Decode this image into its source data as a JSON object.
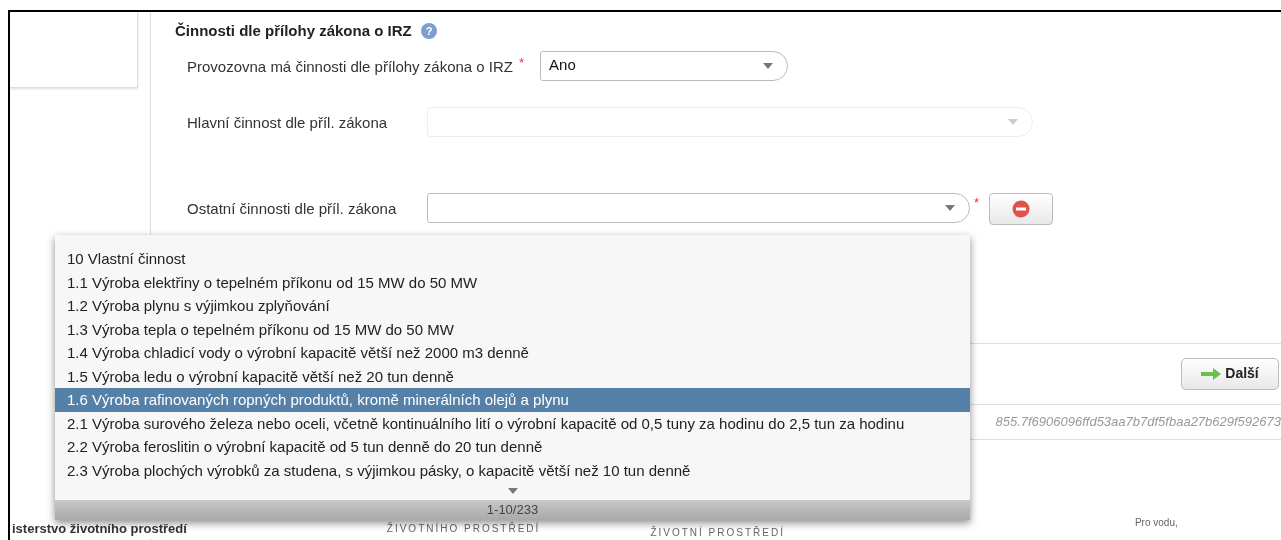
{
  "section": {
    "title": "Činnosti dle přílohy zákona o IRZ",
    "help_icon": "?"
  },
  "required_mark": "*",
  "fields": [
    {
      "label": "Provozovna má činnosti dle přílohy zákona o IRZ",
      "required": true,
      "value": "Ano",
      "disabled": false,
      "kind": "short",
      "removable": false
    },
    {
      "label": "Hlavní činnost dle příl. zákona",
      "required": false,
      "disabled": true,
      "kind": "wide",
      "removable": false
    },
    {
      "label": "Ostatní činnosti dle příl. zákona",
      "required": true,
      "disabled": false,
      "kind": "medium",
      "removable": true
    }
  ],
  "dropdown": {
    "options": [
      {
        "label": "10 Vlastní činnost",
        "selected": false
      },
      {
        "label": "1.1 Výroba elektřiny o tepelném příkonu od 15 MW do 50 MW",
        "selected": false
      },
      {
        "label": "1.2 Výroba plynu s výjimkou zplyňování",
        "selected": false
      },
      {
        "label": "1.3 Výroba tepla o tepelném příkonu od 15 MW do 50 MW",
        "selected": false
      },
      {
        "label": "1.4 Výroba chladicí vody o výrobní kapacitě větší než 2000 m3 denně",
        "selected": false
      },
      {
        "label": "1.5 Výroba ledu o výrobní kapacitě větší než 20 tun denně",
        "selected": false
      },
      {
        "label": "1.6 Výroba rafinovaných ropných produktů, kromě minerálních olejů a plynu",
        "selected": true
      },
      {
        "label": "2.1 Výroba surového železa nebo oceli, včetně kontinuálního lití o výrobní kapacitě od 0,5 tuny za hodinu do 2,5 tun za hodinu",
        "selected": false
      },
      {
        "label": "2.2 Výroba feroslitin o výrobní kapacitě od 5 tun denně do 20 tun denně",
        "selected": false
      },
      {
        "label": "2.3 Výroba plochých výrobků za studena, s výjimkou pásky, o kapacitě větší než 10 tun denně",
        "selected": false
      }
    ],
    "pager": "1-10/233"
  },
  "next_button": "Další",
  "hash": "855.7f6906096ffd53aa7b7df5fbaa27b629f592673",
  "footer": {
    "ministry": "isterstvo životního prostředí",
    "logo_caption": "ŽIVOTNÍHO PROSTŘEDÍ",
    "program_caption": "ŽIVOTNÍ PROSTŘEDÍ",
    "slogan": "Pro vodu,"
  }
}
